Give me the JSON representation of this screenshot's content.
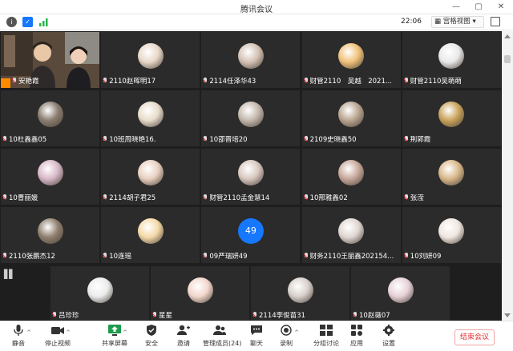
{
  "window": {
    "title": "腾讯会议"
  },
  "infobar": {
    "time": "22:06",
    "view_label": "宫格视图"
  },
  "participants": [
    {
      "name": "安艳霞",
      "host": true
    },
    {
      "name": "2110赵晖明17"
    },
    {
      "name": "2114任泽华43"
    },
    {
      "name": "财管2110　吴越　2021..."
    },
    {
      "name": "财管2110吴萌萌"
    },
    {
      "name": "10杜鑫鑫05"
    },
    {
      "name": "10班周晓艳16."
    },
    {
      "name": "10邵晋培20"
    },
    {
      "name": "2109史晓鑫50"
    },
    {
      "name": "荆郭霞"
    },
    {
      "name": "10曹丽媛"
    },
    {
      "name": "2114胡子君25"
    },
    {
      "name": "财管2110孟金慧14"
    },
    {
      "name": "10邢雅鑫02"
    },
    {
      "name": "张滢"
    },
    {
      "name": "2110张鹏杰12"
    },
    {
      "name": "10连瑶"
    },
    {
      "name": "09严瑞妍49",
      "avatar_text": "49"
    },
    {
      "name": "财务2110王丽鑫202154..."
    },
    {
      "name": "10刘妍09"
    }
  ],
  "bottom_participants": [
    {
      "name": "吕珍珍"
    },
    {
      "name": "星星"
    },
    {
      "name": "2114李俊苗31"
    },
    {
      "name": "10赵薇07"
    }
  ],
  "toolbar": {
    "mute": "静音",
    "stop_video": "停止视频",
    "share": "共享屏幕",
    "security": "安全",
    "invite": "邀请",
    "members": "管理成员(24)",
    "chat": "聊天",
    "record": "录制",
    "breakout": "分组讨论",
    "apps": "应用",
    "settings": "设置",
    "end": "结束会议"
  },
  "colors": {
    "accent": "#1677ff",
    "host_badge": "#ff8a00",
    "end_red": "#e03030",
    "tile_bg": "#2b2b2b"
  }
}
